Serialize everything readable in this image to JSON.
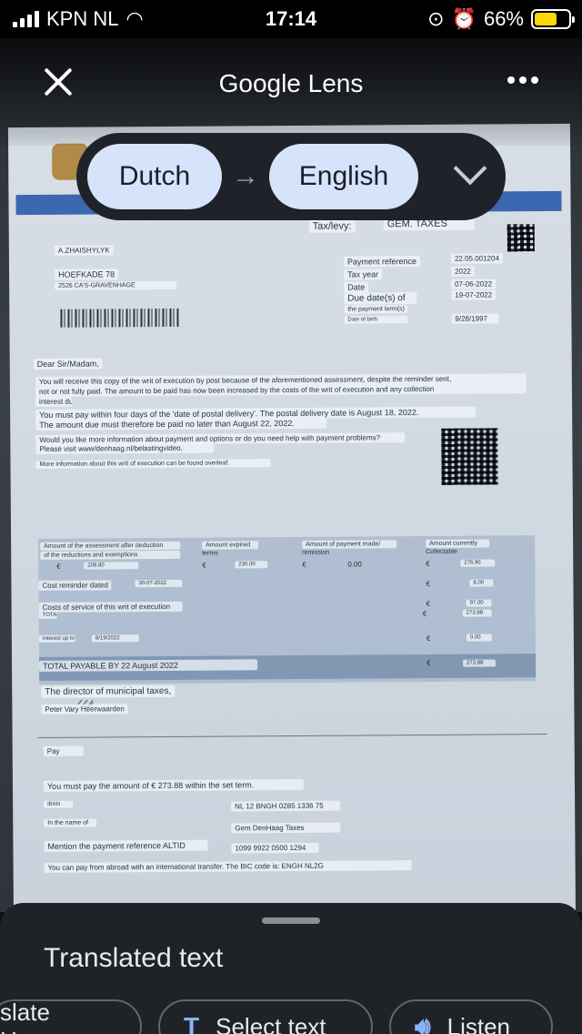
{
  "status": {
    "carrier": "KPN NL",
    "time": "17:14",
    "battery": "66%",
    "battery_level": 0.66
  },
  "header": {
    "title": "Google Lens"
  },
  "languages": {
    "source": "Dutch",
    "target": "English"
  },
  "doc": {
    "taxlevy_label": "Tax/levy:",
    "taxlevy_value": "GEM. TAXES",
    "name": "A.ZHAISHYLYK",
    "street": "HOEFKADE 78",
    "city": "2526 CA'S-GRAVENHAGE",
    "payref_label": "Payment reference",
    "payref_value": "22.05.001204",
    "taxyear_label": "Tax year",
    "taxyear_value": "2022",
    "date_label": "Date",
    "date_value": "07-06-2022",
    "due_label": "Due date(s) of",
    "due_value": "19-07-2022",
    "payterm_label": "the payment term(s)",
    "dob_label": "Date of birth",
    "dob_value": "9/28/1997",
    "greeting": "Dear Sir/Madam,",
    "p1": "You will receive this copy of the writ of execution by post because of the aforementioned assessment, despite the reminder sent,",
    "p1b": "not or not fully paid. The amount to be paid has now been increased by the costs of the writ of execution and any collection",
    "p1c": "interest due.",
    "p2": "You must pay within four days of the 'date of postal delivery'. The postal delivery date is August 18, 2022.",
    "p2b": "The amount due must therefore be paid no later than August 22, 2022.",
    "p3": "Would you like more information about payment and options or do you need help with payment problems?",
    "p3b": "Please visit www/denhaag.nl/belastingvideo.",
    "p4": "More information about this writ of execution can be found overleaf.",
    "col1a": "Amount of the assessment after deduction",
    "col1b": "of the reductions and exemptions",
    "col2a": "Amount expired",
    "col2b": "terms",
    "col3a": "Amount of payment made/",
    "col3b": "remission",
    "col4a": "Amount currently",
    "col4b": "Collectable",
    "euro": "€",
    "v1": "208.80",
    "v2": "230.00",
    "v3": "0.00",
    "v4": "276.90",
    "cost_reminder": "Cost reminder dated",
    "cost_reminder_date": "30-07-2022",
    "cost_reminder_value": "8.00",
    "cost_service": "Costs of service of this writ of execution",
    "cost_service_value": "97.00",
    "total_label": "TOTAL",
    "total_value": "273.88",
    "interest_label": "Interest up to",
    "interest_date": "8/19/2022",
    "interest_value": "0.00",
    "total_payable": "TOTAL PAYABLE BY 22 August 2022",
    "total_payable_value": "273.88",
    "director": "The director of municipal taxes,",
    "signer": "Peter Vary Heerwaarden",
    "pay": "Pay",
    "pay_amount": "You must pay the amount of € 273.88 within the set term.",
    "iban_label": "IBAN",
    "iban_value": "NL 12 BNGH 0285 1336 75",
    "name_label": "In the name of",
    "name_value": "Gem DenHaag Taxes",
    "mention_label": "Mention the payment reference ALTID",
    "mention_value": "1099 9922 0500 1294",
    "abroad": "You can pay from abroad with an international transfer. The BIC code is: ENGH NL2G"
  },
  "sheet": {
    "title": "Translated text",
    "chips": [
      {
        "label": "slate Home",
        "icon": "home-icon"
      },
      {
        "label": "Select text",
        "icon": "text-select-icon"
      },
      {
        "label": "Listen",
        "icon": "speaker-icon"
      }
    ]
  }
}
